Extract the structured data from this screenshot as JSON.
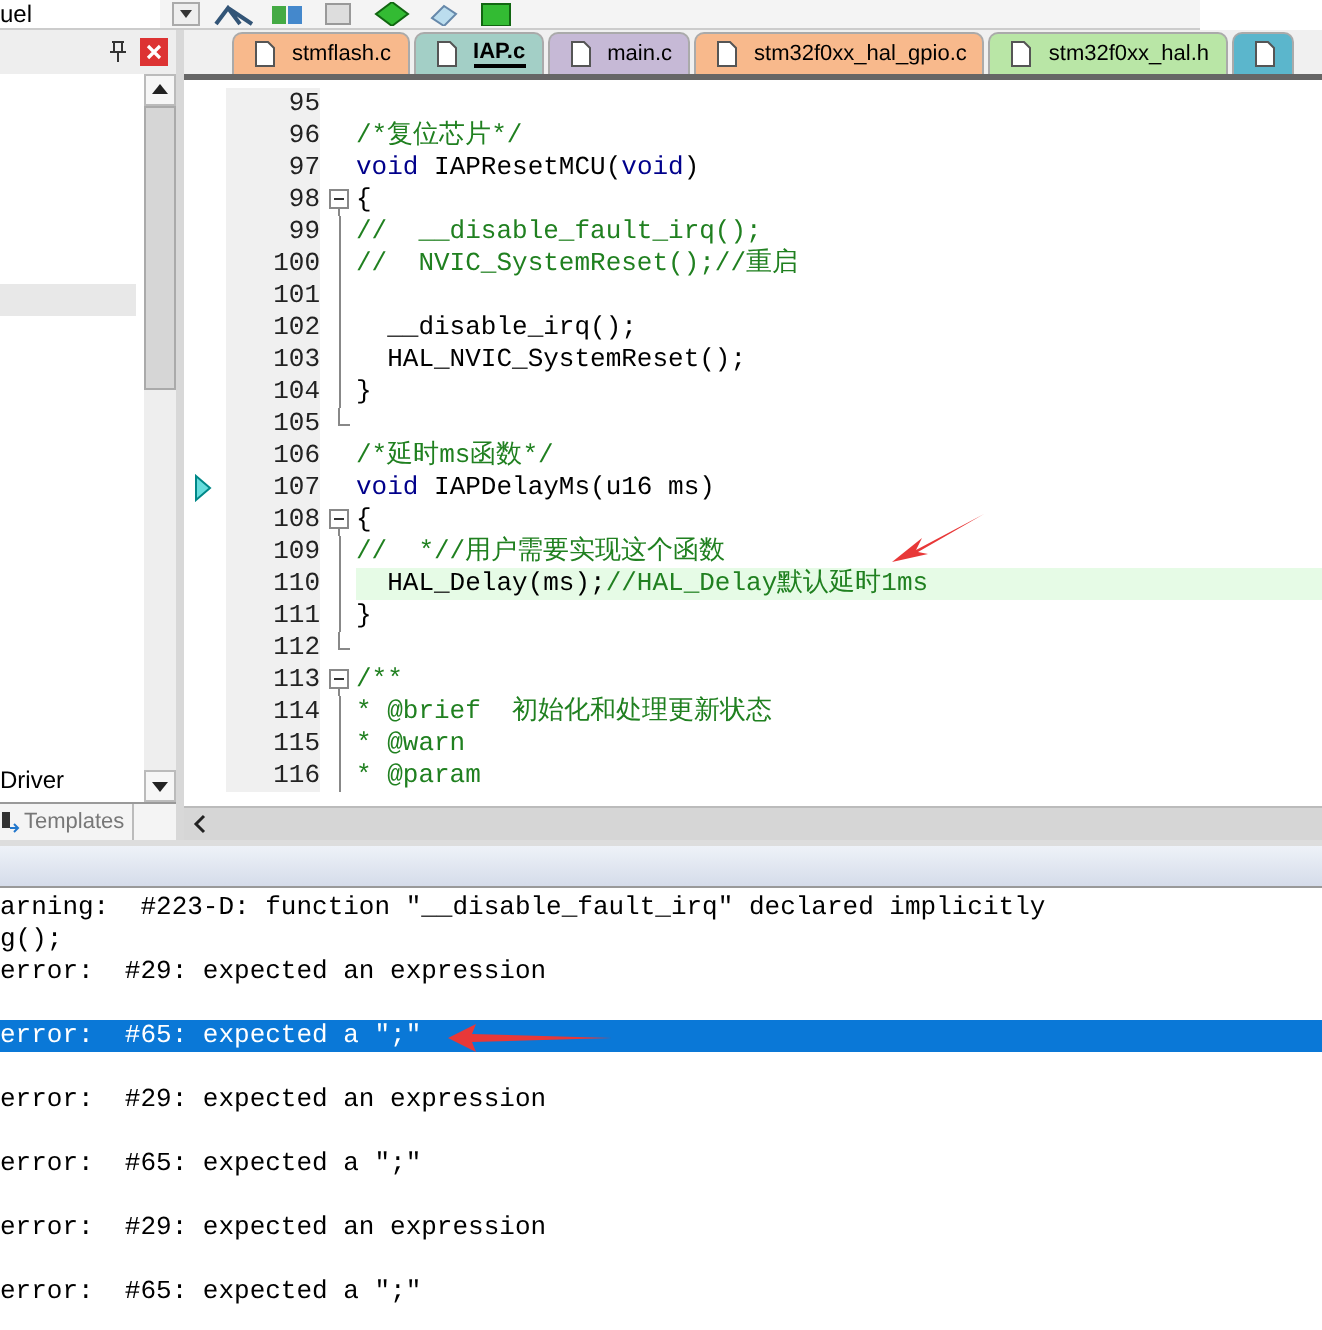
{
  "toolbar": {
    "combo_value": "uel"
  },
  "tabs": [
    {
      "label": "stmflash.c",
      "color": "#f8b98c",
      "selected": false
    },
    {
      "label": "IAP.c",
      "color": "#a3cfc6",
      "selected": true
    },
    {
      "label": "main.c",
      "color": "#c6b9d6",
      "selected": false
    },
    {
      "label": "stm32f0xx_hal_gpio.c",
      "color": "#f8b98c",
      "selected": false
    },
    {
      "label": "stm32f0xx_hal.h",
      "color": "#b9e6a6",
      "selected": false
    }
  ],
  "project_panel": {
    "items": [
      {
        "label": "Driver"
      }
    ],
    "bottom_tab": "Templates"
  },
  "editor": {
    "lines": [
      {
        "number": "95",
        "kind": "plain",
        "current": false,
        "marker": false
      },
      {
        "number": "96",
        "kind": "plain",
        "current": false,
        "marker": false,
        "tokens": [
          {
            "kind": "comment",
            "text": "/*复位芯片*/"
          }
        ]
      },
      {
        "number": "97",
        "kind": "plain",
        "current": false,
        "marker": false,
        "tokens": [
          {
            "kind": "keyword",
            "text": "void"
          },
          {
            "kind": "plain",
            "text": " IAPResetMCU("
          },
          {
            "kind": "keyword",
            "text": "void"
          },
          {
            "kind": "plain",
            "text": ")"
          }
        ]
      },
      {
        "number": "98",
        "kind": "fold_start",
        "current": false,
        "marker": false,
        "tokens": [
          {
            "kind": "plain",
            "text": "{"
          }
        ]
      },
      {
        "number": "99",
        "kind": "fold_body",
        "current": false,
        "marker": false,
        "tokens": [
          {
            "kind": "comment",
            "text": "//  __disable_fault_irq();"
          }
        ]
      },
      {
        "number": "100",
        "kind": "fold_body",
        "current": false,
        "marker": false,
        "tokens": [
          {
            "kind": "comment",
            "text": "//  NVIC_SystemReset();//重启"
          }
        ]
      },
      {
        "number": "101",
        "kind": "fold_body",
        "current": false,
        "marker": false
      },
      {
        "number": "102",
        "kind": "fold_body",
        "current": false,
        "marker": false,
        "tokens": [
          {
            "kind": "plain",
            "text": "  __disable_irq();"
          }
        ]
      },
      {
        "number": "103",
        "kind": "fold_body",
        "current": false,
        "marker": false,
        "tokens": [
          {
            "kind": "plain",
            "text": "  HAL_NVIC_SystemReset();"
          }
        ]
      },
      {
        "number": "104",
        "kind": "fold_body",
        "current": false,
        "marker": false,
        "tokens": [
          {
            "kind": "plain",
            "text": "}"
          }
        ]
      },
      {
        "number": "105",
        "kind": "fold_end",
        "current": false,
        "marker": false
      },
      {
        "number": "106",
        "kind": "plain",
        "current": false,
        "marker": false,
        "tokens": [
          {
            "kind": "comment",
            "text": "/*延时ms函数*/"
          }
        ]
      },
      {
        "number": "107",
        "kind": "plain",
        "current": false,
        "marker": true,
        "tokens": [
          {
            "kind": "keyword",
            "text": "void"
          },
          {
            "kind": "plain",
            "text": " IAPDelayMs(u16 ms)"
          }
        ]
      },
      {
        "number": "108",
        "kind": "fold_start",
        "current": false,
        "marker": false,
        "tokens": [
          {
            "kind": "plain",
            "text": "{"
          }
        ]
      },
      {
        "number": "109",
        "kind": "fold_body",
        "current": false,
        "marker": false,
        "tokens": [
          {
            "kind": "comment",
            "text": "//  *//用户需要实现这个函数"
          }
        ]
      },
      {
        "number": "110",
        "kind": "fold_body",
        "current": true,
        "marker": false,
        "tokens": [
          {
            "kind": "plain",
            "text": "  HAL_Delay(ms);"
          },
          {
            "kind": "comment",
            "text": "//HAL_Delay默认延时1ms"
          }
        ]
      },
      {
        "number": "111",
        "kind": "fold_body",
        "current": false,
        "marker": false,
        "tokens": [
          {
            "kind": "plain",
            "text": "}"
          }
        ]
      },
      {
        "number": "112",
        "kind": "fold_end",
        "current": false,
        "marker": false
      },
      {
        "number": "113",
        "kind": "fold_start",
        "current": false,
        "marker": false,
        "tokens": [
          {
            "kind": "comment",
            "text": "/**"
          }
        ]
      },
      {
        "number": "114",
        "kind": "fold_body",
        "current": false,
        "marker": false,
        "tokens": [
          {
            "kind": "comment",
            "text": "* @brief  初始化和处理更新状态"
          }
        ]
      },
      {
        "number": "115",
        "kind": "fold_body",
        "current": false,
        "marker": false,
        "tokens": [
          {
            "kind": "comment",
            "text": "* @warn"
          }
        ]
      },
      {
        "number": "116",
        "kind": "fold_body",
        "current": false,
        "marker": false,
        "tokens": [
          {
            "kind": "comment",
            "text": "* @param"
          }
        ]
      }
    ]
  },
  "output": {
    "lines": [
      {
        "text": "arning:  #223-D: function \"__disable_fault_irq\" declared implicitly",
        "selected": false
      },
      {
        "text": "g();",
        "selected": false
      },
      {
        "text": "error:  #29: expected an expression",
        "selected": false
      },
      {
        "selected": false
      },
      {
        "text": "error:  #65: expected a \";\"",
        "selected": true
      },
      {
        "selected": false
      },
      {
        "text": "error:  #29: expected an expression",
        "selected": false
      },
      {
        "selected": false
      },
      {
        "text": "error:  #65: expected a \";\"",
        "selected": false
      },
      {
        "selected": false
      },
      {
        "text": "error:  #29: expected an expression",
        "selected": false
      },
      {
        "selected": false
      },
      {
        "text": "error:  #65: expected a \";\"",
        "selected": false
      }
    ]
  }
}
